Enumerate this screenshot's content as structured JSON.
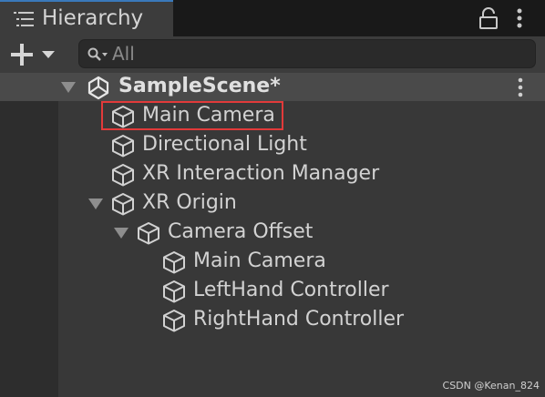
{
  "tab": {
    "title": "Hierarchy"
  },
  "toolbar": {
    "search_placeholder": "All"
  },
  "tree": {
    "scene": {
      "label": "SampleScene*"
    },
    "items": [
      {
        "label": "Main Camera",
        "highlighted": true
      },
      {
        "label": "Directional Light"
      },
      {
        "label": "XR Interaction Manager"
      },
      {
        "label": "XR Origin",
        "expanded": true
      },
      {
        "label": "Camera Offset",
        "expanded": true
      },
      {
        "label": "Main Camera"
      },
      {
        "label": "LeftHand Controller"
      },
      {
        "label": "RightHand Controller"
      }
    ]
  },
  "colors": {
    "highlight_border": "#e23a3a",
    "tab_accent": "#3a79bb"
  },
  "watermark": "CSDN @Kenan_824"
}
